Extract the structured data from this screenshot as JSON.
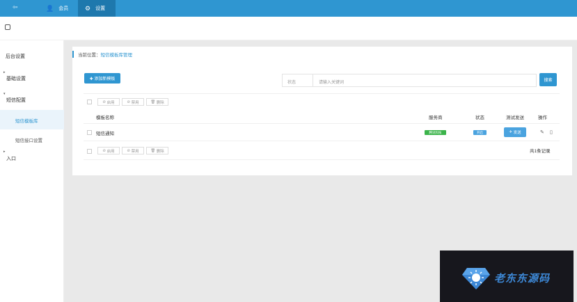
{
  "topbar": {
    "menu_icon": "menu-toggle-icon",
    "nav": [
      {
        "label": "会员",
        "icon": "user-icon"
      },
      {
        "label": "设置",
        "icon": "gear-icon"
      }
    ]
  },
  "subbar": {
    "icon": "home-icon"
  },
  "sidebar": {
    "items": [
      {
        "label": "后台设置"
      },
      {
        "label": "基础设置"
      },
      {
        "label": "短信配置"
      },
      {
        "label": "入口"
      }
    ],
    "subitems": [
      {
        "label": "短信模板库"
      },
      {
        "label": "短信接口设置"
      }
    ]
  },
  "breadcrumb": {
    "prefix": "当前位置：",
    "link": "短信模板库管理"
  },
  "toolbar": {
    "add_label": "✚ 添加新模板",
    "status_label": "状态",
    "search_placeholder": "请输入关键词",
    "search_button": "搜索"
  },
  "batch": {
    "enable": "启用",
    "disable": "禁用",
    "delete": "删除"
  },
  "table": {
    "headers": [
      "模板名称",
      "服务商",
      "状态",
      "测试发送",
      "操作"
    ],
    "rows": [
      {
        "name": "短信通知",
        "provider": "腾讯科技",
        "status": "开启",
        "action": "发送"
      }
    ]
  },
  "footer": {
    "total": "共1条记录"
  },
  "watermark": {
    "text": "老东东源码"
  },
  "colors": {
    "primary": "#2f96d1",
    "green": "#3cb44b",
    "blue": "#4aa3df"
  }
}
